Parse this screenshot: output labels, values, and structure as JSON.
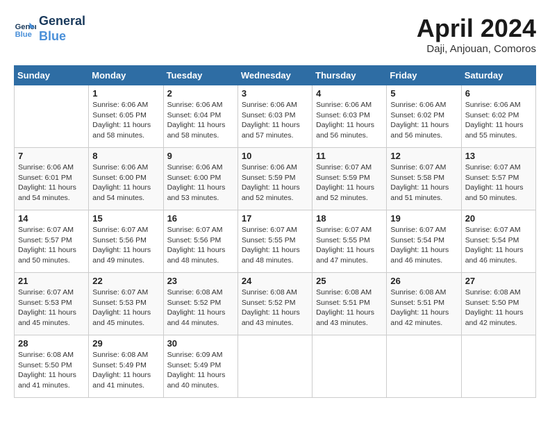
{
  "logo": {
    "line1": "General",
    "line2": "Blue"
  },
  "title": "April 2024",
  "subtitle": "Daji, Anjouan, Comoros",
  "header_days": [
    "Sunday",
    "Monday",
    "Tuesday",
    "Wednesday",
    "Thursday",
    "Friday",
    "Saturday"
  ],
  "weeks": [
    [
      {
        "day": "",
        "info": ""
      },
      {
        "day": "1",
        "info": "Sunrise: 6:06 AM\nSunset: 6:05 PM\nDaylight: 11 hours and 58 minutes."
      },
      {
        "day": "2",
        "info": "Sunrise: 6:06 AM\nSunset: 6:04 PM\nDaylight: 11 hours and 58 minutes."
      },
      {
        "day": "3",
        "info": "Sunrise: 6:06 AM\nSunset: 6:03 PM\nDaylight: 11 hours and 57 minutes."
      },
      {
        "day": "4",
        "info": "Sunrise: 6:06 AM\nSunset: 6:03 PM\nDaylight: 11 hours and 56 minutes."
      },
      {
        "day": "5",
        "info": "Sunrise: 6:06 AM\nSunset: 6:02 PM\nDaylight: 11 hours and 56 minutes."
      },
      {
        "day": "6",
        "info": "Sunrise: 6:06 AM\nSunset: 6:02 PM\nDaylight: 11 hours and 55 minutes."
      }
    ],
    [
      {
        "day": "7",
        "info": "Sunrise: 6:06 AM\nSunset: 6:01 PM\nDaylight: 11 hours and 54 minutes."
      },
      {
        "day": "8",
        "info": "Sunrise: 6:06 AM\nSunset: 6:00 PM\nDaylight: 11 hours and 54 minutes."
      },
      {
        "day": "9",
        "info": "Sunrise: 6:06 AM\nSunset: 6:00 PM\nDaylight: 11 hours and 53 minutes."
      },
      {
        "day": "10",
        "info": "Sunrise: 6:06 AM\nSunset: 5:59 PM\nDaylight: 11 hours and 52 minutes."
      },
      {
        "day": "11",
        "info": "Sunrise: 6:07 AM\nSunset: 5:59 PM\nDaylight: 11 hours and 52 minutes."
      },
      {
        "day": "12",
        "info": "Sunrise: 6:07 AM\nSunset: 5:58 PM\nDaylight: 11 hours and 51 minutes."
      },
      {
        "day": "13",
        "info": "Sunrise: 6:07 AM\nSunset: 5:57 PM\nDaylight: 11 hours and 50 minutes."
      }
    ],
    [
      {
        "day": "14",
        "info": "Sunrise: 6:07 AM\nSunset: 5:57 PM\nDaylight: 11 hours and 50 minutes."
      },
      {
        "day": "15",
        "info": "Sunrise: 6:07 AM\nSunset: 5:56 PM\nDaylight: 11 hours and 49 minutes."
      },
      {
        "day": "16",
        "info": "Sunrise: 6:07 AM\nSunset: 5:56 PM\nDaylight: 11 hours and 48 minutes."
      },
      {
        "day": "17",
        "info": "Sunrise: 6:07 AM\nSunset: 5:55 PM\nDaylight: 11 hours and 48 minutes."
      },
      {
        "day": "18",
        "info": "Sunrise: 6:07 AM\nSunset: 5:55 PM\nDaylight: 11 hours and 47 minutes."
      },
      {
        "day": "19",
        "info": "Sunrise: 6:07 AM\nSunset: 5:54 PM\nDaylight: 11 hours and 46 minutes."
      },
      {
        "day": "20",
        "info": "Sunrise: 6:07 AM\nSunset: 5:54 PM\nDaylight: 11 hours and 46 minutes."
      }
    ],
    [
      {
        "day": "21",
        "info": "Sunrise: 6:07 AM\nSunset: 5:53 PM\nDaylight: 11 hours and 45 minutes."
      },
      {
        "day": "22",
        "info": "Sunrise: 6:07 AM\nSunset: 5:53 PM\nDaylight: 11 hours and 45 minutes."
      },
      {
        "day": "23",
        "info": "Sunrise: 6:08 AM\nSunset: 5:52 PM\nDaylight: 11 hours and 44 minutes."
      },
      {
        "day": "24",
        "info": "Sunrise: 6:08 AM\nSunset: 5:52 PM\nDaylight: 11 hours and 43 minutes."
      },
      {
        "day": "25",
        "info": "Sunrise: 6:08 AM\nSunset: 5:51 PM\nDaylight: 11 hours and 43 minutes."
      },
      {
        "day": "26",
        "info": "Sunrise: 6:08 AM\nSunset: 5:51 PM\nDaylight: 11 hours and 42 minutes."
      },
      {
        "day": "27",
        "info": "Sunrise: 6:08 AM\nSunset: 5:50 PM\nDaylight: 11 hours and 42 minutes."
      }
    ],
    [
      {
        "day": "28",
        "info": "Sunrise: 6:08 AM\nSunset: 5:50 PM\nDaylight: 11 hours and 41 minutes."
      },
      {
        "day": "29",
        "info": "Sunrise: 6:08 AM\nSunset: 5:49 PM\nDaylight: 11 hours and 41 minutes."
      },
      {
        "day": "30",
        "info": "Sunrise: 6:09 AM\nSunset: 5:49 PM\nDaylight: 11 hours and 40 minutes."
      },
      {
        "day": "",
        "info": ""
      },
      {
        "day": "",
        "info": ""
      },
      {
        "day": "",
        "info": ""
      },
      {
        "day": "",
        "info": ""
      }
    ]
  ]
}
